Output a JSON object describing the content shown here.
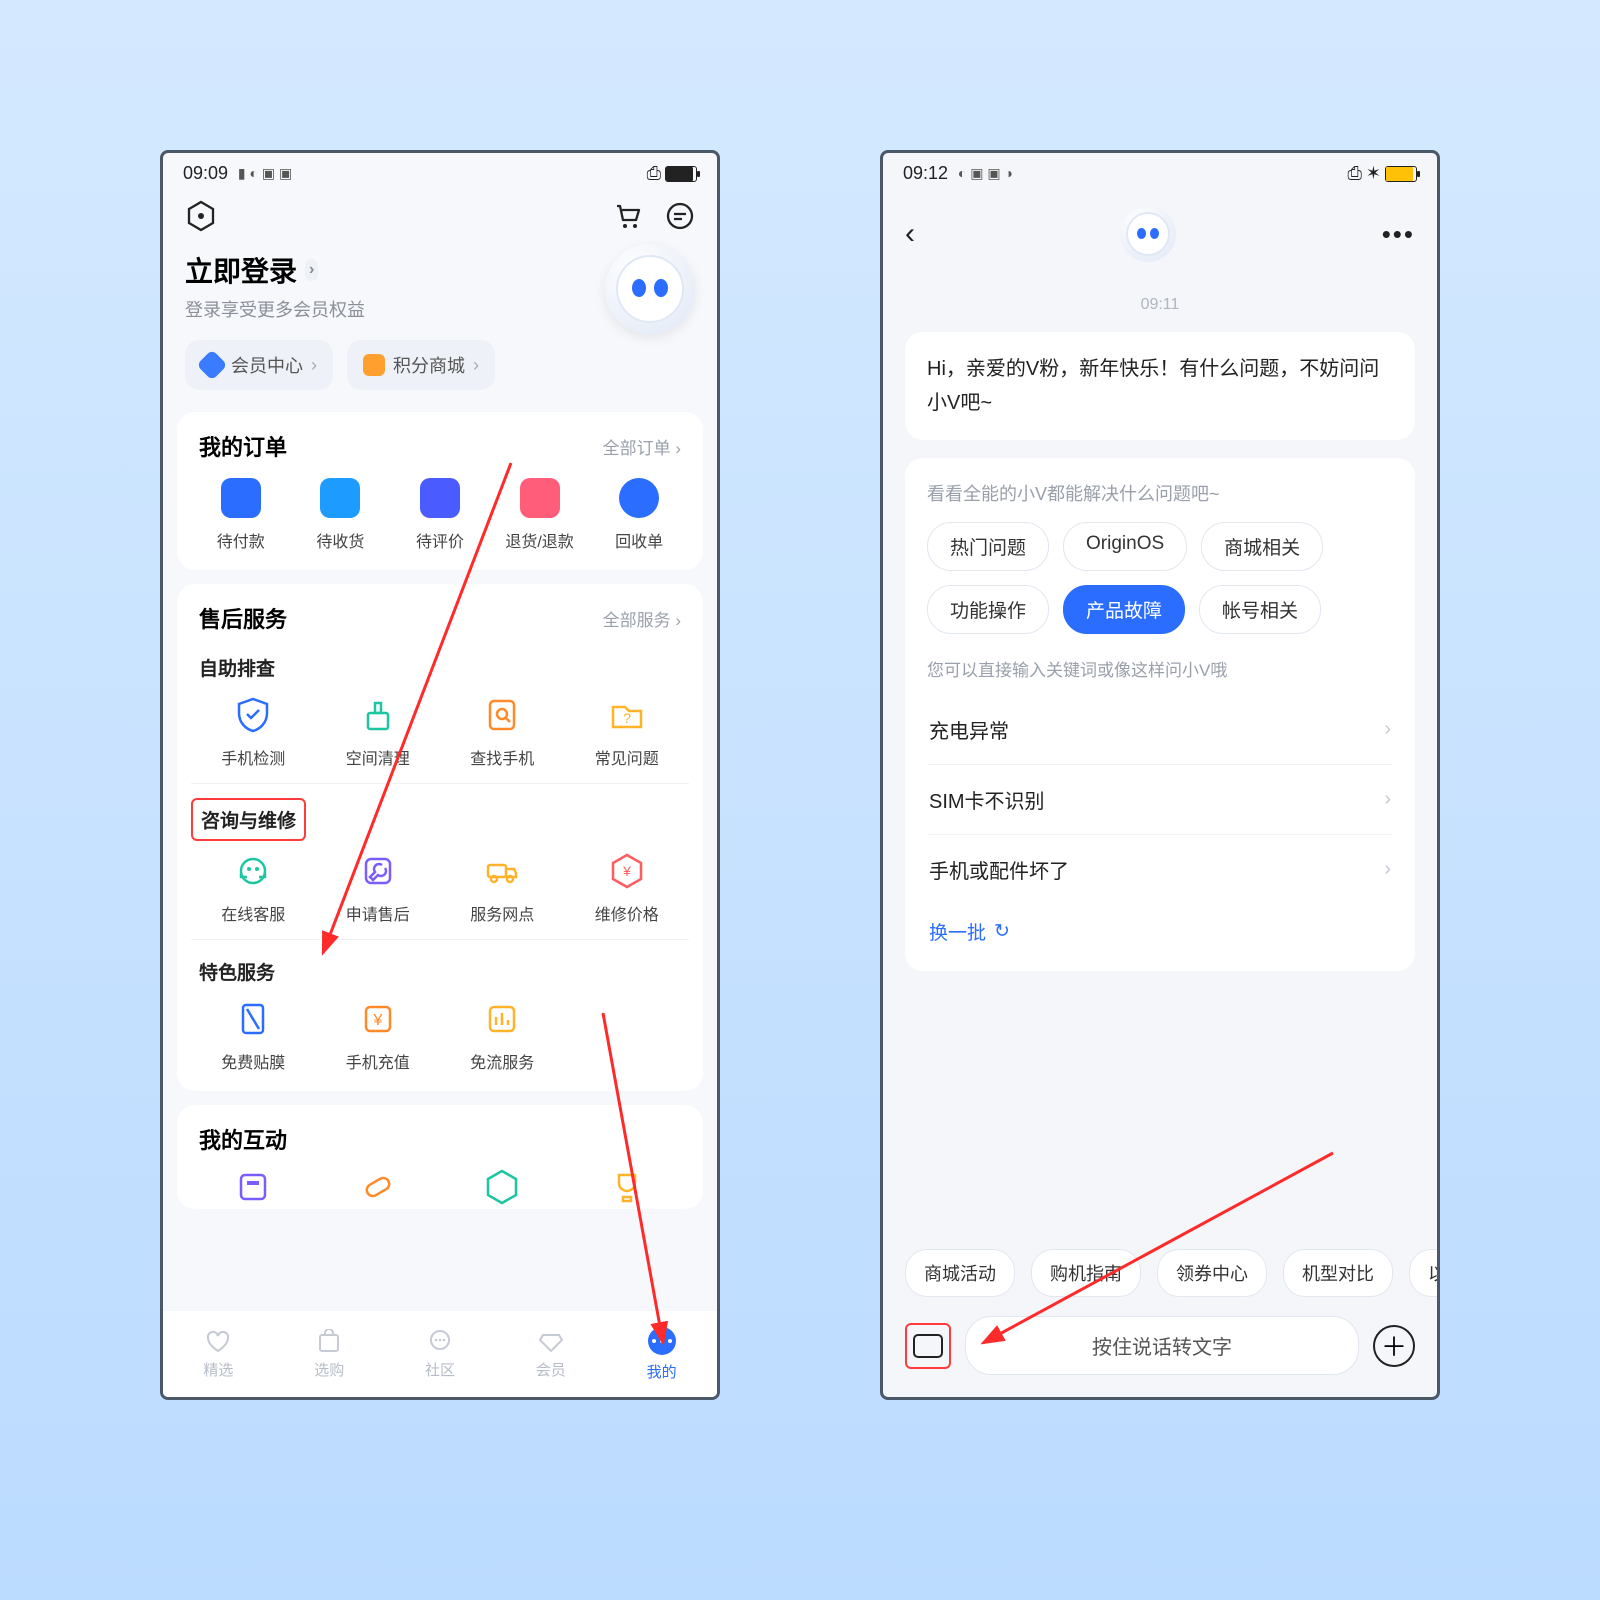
{
  "screen1": {
    "status_time": "09:09",
    "login_title": "立即登录",
    "login_sub": "登录享受更多会员权益",
    "member_center": "会员中心",
    "points_mall": "积分商城",
    "orders_title": "我的订单",
    "orders_more": "全部订单",
    "order_items": [
      {
        "label": "待付款"
      },
      {
        "label": "待收货"
      },
      {
        "label": "待评价"
      },
      {
        "label": "退货/退款"
      },
      {
        "label": "回收单"
      }
    ],
    "aftersale_title": "售后服务",
    "aftersale_more": "全部服务",
    "sec_self": "自助排查",
    "self_items": [
      {
        "label": "手机检测"
      },
      {
        "label": "空间清理"
      },
      {
        "label": "查找手机"
      },
      {
        "label": "常见问题"
      }
    ],
    "sec_consult": "咨询与维修",
    "consult_items": [
      {
        "label": "在线客服"
      },
      {
        "label": "申请售后"
      },
      {
        "label": "服务网点"
      },
      {
        "label": "维修价格"
      }
    ],
    "sec_special": "特色服务",
    "special_items": [
      {
        "label": "免费贴膜"
      },
      {
        "label": "手机充值"
      },
      {
        "label": "免流服务"
      }
    ],
    "interact_title": "我的互动",
    "tabs": [
      {
        "label": "精选"
      },
      {
        "label": "选购"
      },
      {
        "label": "社区"
      },
      {
        "label": "会员"
      },
      {
        "label": "我的"
      }
    ]
  },
  "screen2": {
    "status_time": "09:12",
    "msg_time": "09:11",
    "greeting": "Hi，亲爱的V粉，新年快乐！有什么问题，不妨问问小V吧~",
    "panel_head": "看看全能的小V都能解决什么问题吧~",
    "chips": [
      {
        "t": "热门问题"
      },
      {
        "t": "OriginOS"
      },
      {
        "t": "商城相关"
      },
      {
        "t": "功能操作"
      },
      {
        "t": "产品故障",
        "sel": true
      },
      {
        "t": "帐号相关"
      }
    ],
    "hint": "您可以直接输入关键词或像这样问小V哦",
    "faq": [
      {
        "t": "充电异常"
      },
      {
        "t": "SIM卡不识别"
      },
      {
        "t": "手机或配件坏了"
      }
    ],
    "refresh": "换一批",
    "bottom_chips": [
      {
        "t": "商城活动"
      },
      {
        "t": "购机指南"
      },
      {
        "t": "领券中心"
      },
      {
        "t": "机型对比"
      },
      {
        "t": "以"
      }
    ],
    "input_placeholder": "按住说话转文字"
  }
}
